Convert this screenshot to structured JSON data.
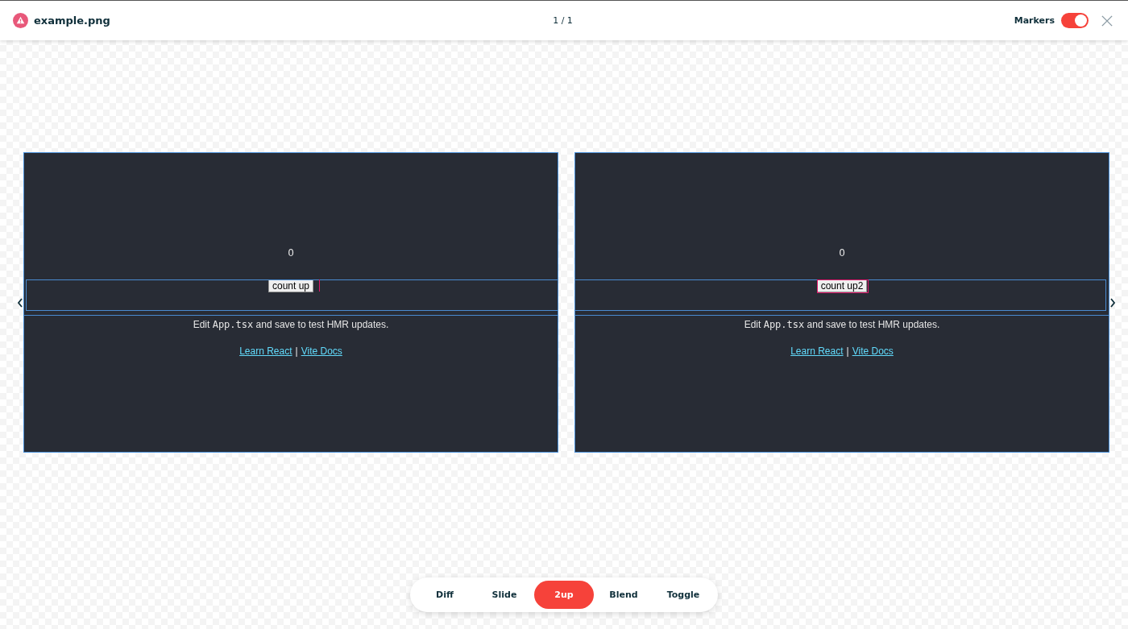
{
  "header": {
    "filename": "example.png",
    "pager": "1 / 1",
    "markers_label": "Markers",
    "markers_on": true
  },
  "panels": [
    {
      "count": "0",
      "button": "count up",
      "edit_before": "Edit ",
      "edit_code": "App.tsx",
      "edit_after": " and save to test HMR updates.",
      "links": [
        "Learn React",
        "Vite Docs"
      ],
      "separator": "|"
    },
    {
      "count": "0",
      "button": "count up2",
      "edit_before": "Edit ",
      "edit_code": "App.tsx",
      "edit_after": " and save to test HMR updates.",
      "links": [
        "Learn React",
        "Vite Docs"
      ],
      "separator": "|"
    }
  ],
  "modes": [
    {
      "label": "Diff",
      "selected": false
    },
    {
      "label": "Slide",
      "selected": false
    },
    {
      "label": "2up",
      "selected": true
    },
    {
      "label": "Blend",
      "selected": false
    },
    {
      "label": "Toggle",
      "selected": false
    }
  ]
}
